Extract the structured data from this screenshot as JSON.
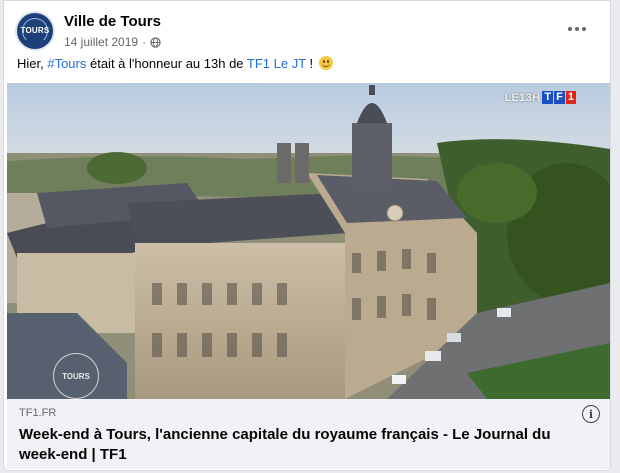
{
  "post": {
    "page_name": "Ville de Tours",
    "date": "14 juillet 2019",
    "separator": "·",
    "avatar_text": "TOURS",
    "text_before": "Hier, ",
    "hashtag": "#Tours",
    "text_middle": " était à l'honneur au 13h de ",
    "mention": "TF1 Le JT",
    "text_after": " ! ",
    "emoji": "smiling-face"
  },
  "video": {
    "watermark_prefix": "LE13H",
    "watermark_logo": [
      "T",
      "F",
      "1"
    ],
    "corner_logo_text": "TOURS"
  },
  "link_preview": {
    "domain": "TF1.FR",
    "title": "Week-end à Tours, l'ancienne capitale du royaume français - Le Journal du week-end | TF1",
    "info_label": "i"
  },
  "colors": {
    "link": "#216fdb",
    "avatar_bg": "#1d3f7a",
    "preview_bg": "#f0f2f5"
  }
}
